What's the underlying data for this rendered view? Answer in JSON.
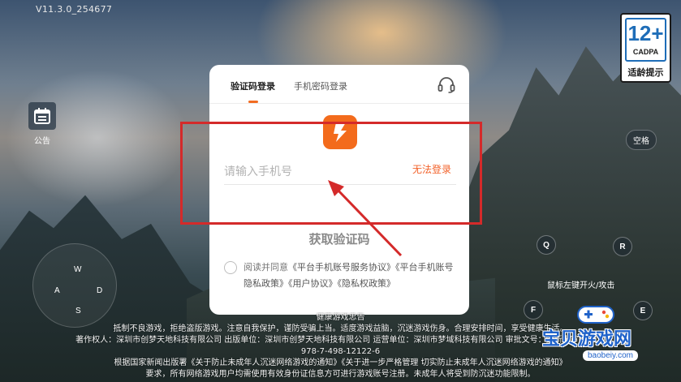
{
  "version": "V11.3.0_254677",
  "rating": {
    "age": "12+",
    "org": "CADPA",
    "tip": "适龄提示"
  },
  "notice": {
    "label": "公告",
    "icon": "calendar-icon"
  },
  "keys": {
    "space": "空格",
    "q": "Q",
    "r": "R",
    "f": "F",
    "e": "E",
    "w": "W",
    "a": "A",
    "s": "S",
    "d": "D",
    "mouse_hint": "鼠标左键开火/攻击"
  },
  "login": {
    "tabs": [
      {
        "label": "验证码登录",
        "active": true
      },
      {
        "label": "手机密码登录",
        "active": false
      }
    ],
    "support_icon": "headset-icon",
    "phone_placeholder": "请输入手机号",
    "cant_login": "无法登录",
    "get_code": "获取验证码",
    "agreement_prefix": "阅读并同意",
    "agreement_links": [
      "《平台手机账号服务协议》",
      "《平台手机账号隐私政策》",
      "《用户协议》",
      "《隐私权政策》"
    ]
  },
  "footer": {
    "lines": [
      "健康游戏忠告",
      "抵制不良游戏，拒绝盗版游戏。注意自我保护，谨防受骗上当。适度游戏益脑，沉迷游戏伤身。合理安排时间，享受健康生活。",
      "著作权人：深圳市创梦天地科技有限公司 出版单位：深圳市创梦天地科技有限公司 运营单位：深圳市梦域科技有限公司 审批文号：国新出审[2023]",
      "978-7-498-12122-6",
      "根据国家新闻出版署《关于防止未成年人沉迷网络游戏的通知》《关于进一步严格管理 切实防止未成年人沉迷网络游戏的通知》",
      "要求，所有网络游戏用户均需使用有效身份证信息方可进行游戏账号注册。未成年人将受到防沉迷功能限制。"
    ]
  },
  "watermark": {
    "text": "宝贝游戏网",
    "domain": "baobeiy.com"
  },
  "colors": {
    "accent": "#f26c22",
    "annotation": "#d42a2a"
  }
}
